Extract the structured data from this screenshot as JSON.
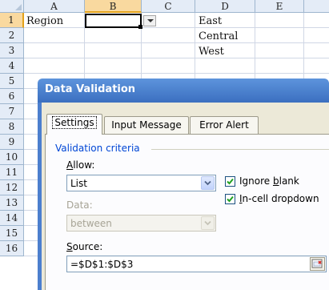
{
  "sheet": {
    "columns": [
      "A",
      "B",
      "C",
      "D",
      "E"
    ],
    "rows": [
      "1",
      "2",
      "3",
      "4",
      "5",
      "6",
      "7",
      "8",
      "9",
      "10",
      "11",
      "12",
      "13",
      "14",
      "15",
      "16"
    ],
    "cells": {
      "A1": "Region",
      "D1": "East",
      "D2": "Central",
      "D3": "West"
    },
    "active_cell": "B1",
    "accent_color": "#e3a21a"
  },
  "dialog": {
    "title": "Data Validation",
    "tabs": [
      "Settings",
      "Input Message",
      "Error Alert"
    ],
    "active_tab": "Settings",
    "criteria_label": "Validation criteria",
    "allow_label": "Allow:",
    "allow_value": "List",
    "data_label": "Data:",
    "data_value": "between",
    "ignore_blank": {
      "label": "Ignore blank",
      "checked": true
    },
    "in_cell_dropdown": {
      "label": "In-cell dropdown",
      "checked": true
    },
    "source_label": "Source:",
    "source_value": "=$D$1:$D$3",
    "title_bar_color": "#4a82d0"
  }
}
